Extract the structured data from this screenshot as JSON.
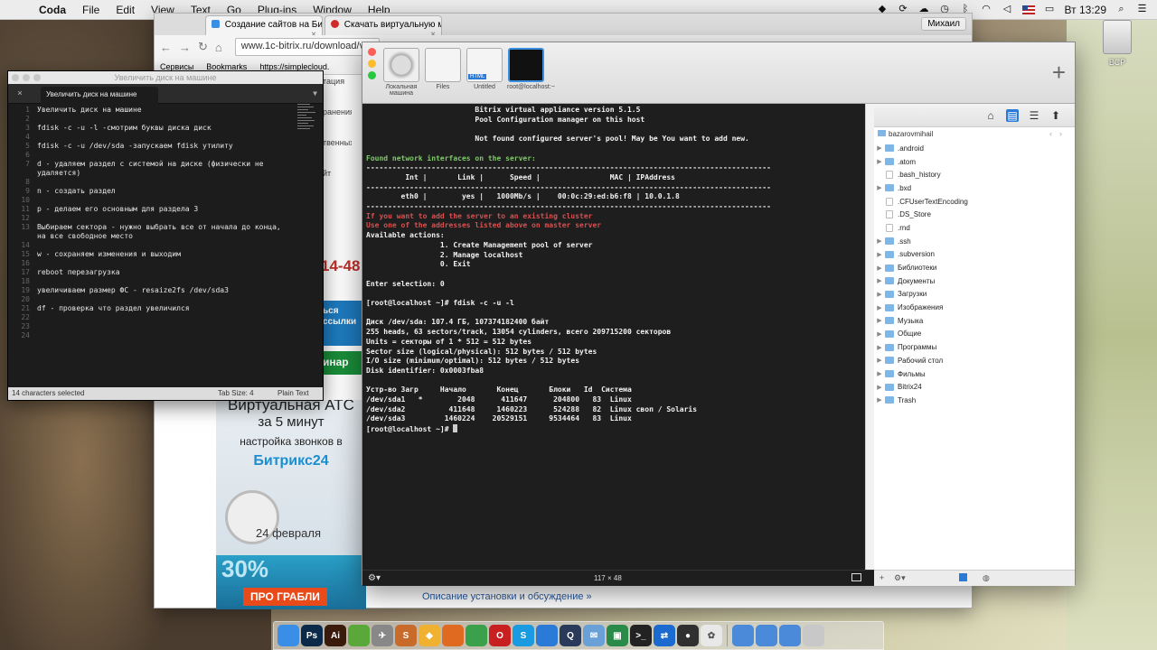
{
  "menubar": {
    "app_name": "Coda",
    "items": [
      "File",
      "Edit",
      "View",
      "Text",
      "Go",
      "Plug-ins",
      "Window",
      "Help"
    ],
    "clock": "Вт 13:29"
  },
  "desktop": {
    "drive_label": "ВСР"
  },
  "browser": {
    "tabs": [
      "Создание сайтов на Битр",
      "Скачать виртуальную ма"
    ],
    "user_button": "Михаил",
    "url": "www.1c-bitrix.ru/download/vm",
    "bookmarks": [
      "Сервисы",
      "Bookmarks",
      "https://simplecloud."
    ],
    "side_fragments": [
      "тация",
      "ранения",
      "твенных",
      "йт"
    ],
    "phone_fragment": "14-48",
    "banner1": "ься\nссылки",
    "banner2": "инар",
    "ad": {
      "l1": "Виртуальная АТС",
      "l2": "за 5 минут",
      "l3": "настройка звонков в",
      "l4": "Битрикс24",
      "l5": "24 февраля"
    },
    "ad2": {
      "pct": "30%",
      "btn": "ПРО ГРАБЛИ"
    },
    "bottom_link": "Описание установки и обсуждение »"
  },
  "coda": {
    "window_title": "Увеличить диск на машине",
    "tab_label": "Увеличить диск на машине",
    "lines": [
      {
        "n": "1",
        "t": "Увеличить диск на машине"
      },
      {
        "n": "2",
        "t": ""
      },
      {
        "n": "3",
        "t": "fdisk -c -u -l -смотрим буквы диска диск"
      },
      {
        "n": "4",
        "t": ""
      },
      {
        "n": "5",
        "t": "fdisk -c -u /dev/sda -запускаем fdisk утилиту"
      },
      {
        "n": "6",
        "t": ""
      },
      {
        "n": "7",
        "t": "d - удаляем раздел с системой на диске (физически не удаляется)"
      },
      {
        "n": "8",
        "t": ""
      },
      {
        "n": "9",
        "t": "n - создать раздел"
      },
      {
        "n": "10",
        "t": ""
      },
      {
        "n": "11",
        "t": "p - делаем его основным для раздела 3"
      },
      {
        "n": "12",
        "t": ""
      },
      {
        "n": "13",
        "t": "Выбираем сектора - нужно выбрать все от начала до конца, на все свободное место"
      },
      {
        "n": "14",
        "t": ""
      },
      {
        "n": "15",
        "t": "w - сохраняем изменения и выходим"
      },
      {
        "n": "16",
        "t": ""
      },
      {
        "n": "17",
        "t": "reboot перезагрузка"
      },
      {
        "n": "18",
        "t": ""
      },
      {
        "n": "19",
        "t": "увеличиваем размер ФС - resaize2fs /dev/sda3"
      },
      {
        "n": "20",
        "t": ""
      },
      {
        "n": "21",
        "t": "df - проверка что раздел увеличился"
      },
      {
        "n": "22",
        "t": ""
      },
      {
        "n": "23",
        "t": ""
      },
      {
        "n": "24",
        "t": ""
      }
    ],
    "status": {
      "selection": "14 characters selected",
      "tab_size": "Tab Size: 4",
      "mode": "Plain Text"
    }
  },
  "vm": {
    "thumbs": [
      "Локальная машина",
      "Files",
      "Untitled",
      "root@localhost:~"
    ],
    "thumb_html_badge": "HTML",
    "terminal_lines": [
      {
        "t": "                         Bitrix virtual appliance version 5.1.5",
        "c": ""
      },
      {
        "t": "                         Pool Configuration manager on this host",
        "c": ""
      },
      {
        "t": "",
        "c": ""
      },
      {
        "t": "                         Not found configured server's pool! May be You want to add new.",
        "c": ""
      },
      {
        "t": "",
        "c": ""
      },
      {
        "t": "Found network interfaces on the server:",
        "c": "green"
      },
      {
        "t": "---------------------------------------------------------------------------------------------",
        "c": ""
      },
      {
        "t": "         Int |       Link |      Speed |                MAC | IPAddress",
        "c": ""
      },
      {
        "t": "---------------------------------------------------------------------------------------------",
        "c": ""
      },
      {
        "t": "        eth0 |        yes |   1000Mb/s |    00:0c:29:ed:b6:f8 | 10.0.1.8",
        "c": ""
      },
      {
        "t": "---------------------------------------------------------------------------------------------",
        "c": ""
      },
      {
        "t": "If you want to add the server to an existing cluster",
        "c": "red"
      },
      {
        "t": "Use one of the addresses listed above on master server",
        "c": "red"
      },
      {
        "t": "Available actions:",
        "c": ""
      },
      {
        "t": "                 1. Create Management pool of server",
        "c": ""
      },
      {
        "t": "                 2. Manage localhost",
        "c": ""
      },
      {
        "t": "                 0. Exit",
        "c": ""
      },
      {
        "t": "",
        "c": ""
      },
      {
        "t": "Enter selection: 0",
        "c": ""
      },
      {
        "t": "",
        "c": ""
      },
      {
        "t": "[root@localhost ~]# fdisk -c -u -l",
        "c": ""
      },
      {
        "t": "",
        "c": ""
      },
      {
        "t": "Диск /dev/sda: 107.4 ГБ, 107374182400 байт",
        "c": ""
      },
      {
        "t": "255 heads, 63 sectors/track, 13054 cylinders, всего 209715200 секторов",
        "c": ""
      },
      {
        "t": "Units = секторы of 1 * 512 = 512 bytes",
        "c": ""
      },
      {
        "t": "Sector size (logical/physical): 512 bytes / 512 bytes",
        "c": ""
      },
      {
        "t": "I/O size (minimum/optimal): 512 bytes / 512 bytes",
        "c": ""
      },
      {
        "t": "Disk identifier: 0x0003fba8",
        "c": ""
      },
      {
        "t": "",
        "c": ""
      },
      {
        "t": "Устр-во Загр     Начало       Конец       Блоки   Id  Система",
        "c": ""
      },
      {
        "t": "/dev/sda1   *        2048      411647      204800   83  Linux",
        "c": ""
      },
      {
        "t": "/dev/sda2          411648     1460223      524288   82  Linux своп / Solaris",
        "c": ""
      },
      {
        "t": "/dev/sda3         1460224    20529151     9534464   83  Linux",
        "c": ""
      },
      {
        "t": "[root@localhost ~]# ",
        "c": "",
        "cursor": true
      }
    ],
    "term_size": "117 × 48",
    "files": {
      "path": "bazarovmihail",
      "items": [
        {
          "name": ".android",
          "type": "folder",
          "exp": true
        },
        {
          "name": ".atom",
          "type": "folder",
          "exp": true
        },
        {
          "name": ".bash_history",
          "type": "doc",
          "exp": false
        },
        {
          "name": ".bxd",
          "type": "folder",
          "exp": true
        },
        {
          "name": ".CFUserTextEncoding",
          "type": "doc",
          "exp": false
        },
        {
          "name": ".DS_Store",
          "type": "doc",
          "exp": false
        },
        {
          "name": ".rnd",
          "type": "doc",
          "exp": false
        },
        {
          "name": ".ssh",
          "type": "folder",
          "exp": true
        },
        {
          "name": ".subversion",
          "type": "folder",
          "exp": true
        },
        {
          "name": "Библиотеки",
          "type": "folder",
          "exp": true
        },
        {
          "name": "Документы",
          "type": "folder",
          "exp": true
        },
        {
          "name": "Загрузки",
          "type": "folder",
          "exp": true
        },
        {
          "name": "Изображения",
          "type": "folder",
          "exp": true
        },
        {
          "name": "Музыка",
          "type": "folder",
          "exp": true
        },
        {
          "name": "Общие",
          "type": "folder",
          "exp": true
        },
        {
          "name": "Программы",
          "type": "folder",
          "exp": true
        },
        {
          "name": "Рабочий стол",
          "type": "folder",
          "exp": true
        },
        {
          "name": "Фильмы",
          "type": "folder",
          "exp": true
        },
        {
          "name": "Bitrix24",
          "type": "folder",
          "exp": true
        },
        {
          "name": "Trash",
          "type": "folder",
          "exp": true
        }
      ]
    }
  },
  "dock": {
    "apps": [
      {
        "name": "finder",
        "color": "#3a8ee6",
        "glyph": ""
      },
      {
        "name": "photoshop",
        "color": "#0b2a4a",
        "glyph": "Ps"
      },
      {
        "name": "illustrator",
        "color": "#3a1a0a",
        "glyph": "Ai"
      },
      {
        "name": "coda-leaf",
        "color": "#5aa83a",
        "glyph": ""
      },
      {
        "name": "rocket",
        "color": "#888888",
        "glyph": "✈"
      },
      {
        "name": "sublime",
        "color": "#c86a2a",
        "glyph": "S"
      },
      {
        "name": "sketch",
        "color": "#f0b030",
        "glyph": "◆"
      },
      {
        "name": "firefox",
        "color": "#e06a20",
        "glyph": ""
      },
      {
        "name": "chrome",
        "color": "#3aa04a",
        "glyph": ""
      },
      {
        "name": "opera",
        "color": "#c82020",
        "glyph": "O"
      },
      {
        "name": "skype",
        "color": "#1a9ae0",
        "glyph": "S"
      },
      {
        "name": "safari",
        "color": "#2a7ad8",
        "glyph": ""
      },
      {
        "name": "quicktime",
        "color": "#2a3a5a",
        "glyph": "Q"
      },
      {
        "name": "mail",
        "color": "#6aa0d8",
        "glyph": "✉"
      },
      {
        "name": "vm",
        "color": "#2a8a4a",
        "glyph": "▣"
      },
      {
        "name": "terminal",
        "color": "#222222",
        "glyph": ">_"
      },
      {
        "name": "teamviewer",
        "color": "#1a6ad0",
        "glyph": "⇄"
      },
      {
        "name": "obs",
        "color": "#303030",
        "glyph": "●"
      },
      {
        "name": "photos",
        "color": "#e8e8e8",
        "glyph": "✿"
      },
      {
        "name": "folder-apps",
        "color": "#4a8ad8",
        "glyph": ""
      },
      {
        "name": "folder-docs",
        "color": "#4a8ad8",
        "glyph": ""
      },
      {
        "name": "folder-downloads",
        "color": "#4a8ad8",
        "glyph": ""
      },
      {
        "name": "trash",
        "color": "#c8c8c8",
        "glyph": ""
      }
    ]
  }
}
